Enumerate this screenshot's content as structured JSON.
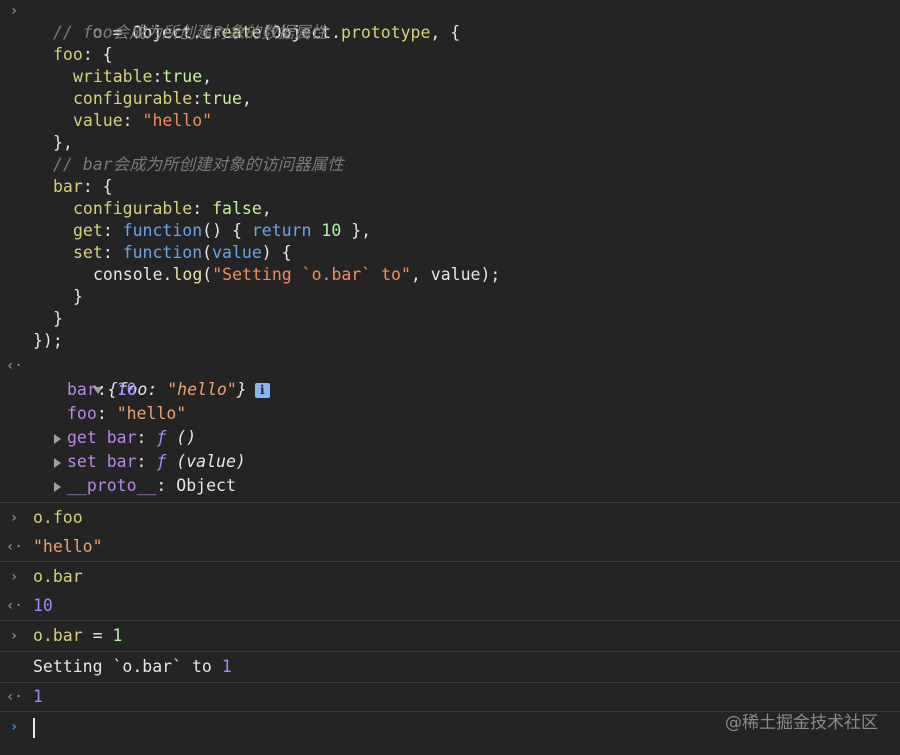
{
  "icons": {
    "input_prompt": "chevron-right-icon",
    "output_prompt": "return-arrow-icon",
    "expand": "triangle-right-icon",
    "collapse": "triangle-down-icon",
    "info": "info-icon"
  },
  "glyphs": {
    "input": "›",
    "output": "‹·",
    "caret_prompt": "›"
  },
  "code": {
    "l1": [
      "o",
      " = ",
      "Object",
      ".",
      "create",
      "(",
      "Object",
      ".",
      "prototype",
      ", {"
    ],
    "l2": "// foo会成为所创建对象的数据属性",
    "l3_key": "foo",
    "l3_rest": ": {",
    "l4_key": "writable",
    "l4_sep": ":",
    "l4_val": "true",
    "l4_end": ",",
    "l5_key": "configurable",
    "l5_sep": ":",
    "l5_val": "true",
    "l5_end": ",",
    "l6_key": "value",
    "l6_sep": ": ",
    "l6_val": "\"hello\"",
    "l7": "},",
    "l8": "// bar会成为所创建对象的访问器属性",
    "l9_key": "bar",
    "l9_rest": ": {",
    "l10_key": "configurable",
    "l10_sep": ": ",
    "l10_val": "false",
    "l10_end": ",",
    "l11_key": "get",
    "l11_sep": ": ",
    "l11_kw": "function",
    "l11_a": "() { ",
    "l11_ret": "return",
    "l11_sp": " ",
    "l11_num": "10",
    "l11_end": " },",
    "l12_key": "set",
    "l12_sep": ": ",
    "l12_kw": "function",
    "l12_a": "(",
    "l12_param": "value",
    "l12_b": ") {",
    "l13_obj": "console",
    "l13_dot": ".",
    "l13_fn": "log",
    "l13_a": "(",
    "l13_str": "\"Setting `o.bar` to\"",
    "l13_b": ", value);",
    "l14": "}",
    "l15": "}",
    "l16": "});"
  },
  "result_object": {
    "summary_open": "{",
    "summary_key": "foo",
    "summary_sep": ": ",
    "summary_val": "\"hello\"",
    "summary_close": "}",
    "info": "i",
    "props": {
      "bar_key": "bar",
      "bar_sep": ": ",
      "bar_val": "10",
      "foo_key": "foo",
      "foo_sep": ": ",
      "foo_val": "\"hello\"",
      "get_key": "get bar",
      "get_sep": ": ",
      "get_f": "ƒ",
      "get_sig": " ()",
      "set_key": "set bar",
      "set_sep": ": ",
      "set_f": "ƒ",
      "set_sig": " (value)",
      "proto_key": "__proto__",
      "proto_sep": ": ",
      "proto_val": "Object"
    }
  },
  "entries": [
    {
      "input": "o.foo",
      "output": "\"hello\""
    },
    {
      "input": "o.bar",
      "output": "10"
    },
    {
      "input_a": "o.bar",
      "input_b": " = ",
      "input_c": "1",
      "log_a": "Setting `o.bar` to ",
      "log_b": "1",
      "output": "1"
    }
  ],
  "watermark": "@稀土掘金技术社区",
  "colors": {
    "background": "#242424",
    "string": "#f08d5d",
    "keyword": "#c792ea",
    "number": "#9a8cff"
  }
}
